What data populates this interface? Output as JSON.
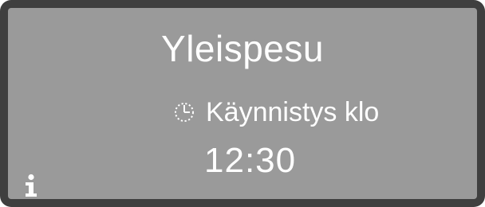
{
  "display": {
    "program_name": "Yleispesu",
    "start_label": "Käynnistys klo",
    "start_time": "12:30",
    "icons": {
      "start_icon": "clock-icon",
      "info_icon": "info-icon"
    },
    "colors": {
      "screen_background": "#9a9a9a",
      "frame": "#3f3f3f",
      "text": "#ffffff"
    }
  }
}
